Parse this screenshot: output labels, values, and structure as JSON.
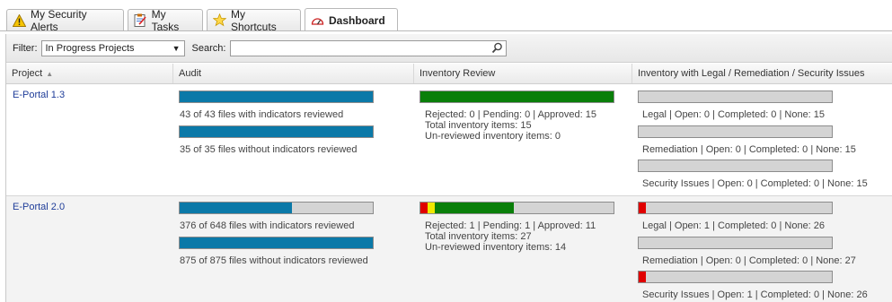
{
  "tabs": [
    {
      "label": "My Security Alerts",
      "icon": "warning-icon"
    },
    {
      "label": "My Tasks",
      "icon": "tasks-icon"
    },
    {
      "label": "My Shortcuts",
      "icon": "star-icon"
    },
    {
      "label": "Dashboard",
      "icon": "gauge-icon"
    }
  ],
  "filter": {
    "label": "Filter:",
    "value": "In Progress Projects",
    "search_label": "Search:",
    "search_value": ""
  },
  "columns": {
    "project": "Project",
    "audit": "Audit",
    "inventory": "Inventory Review",
    "issues": "Inventory with Legal / Remediation / Security Issues"
  },
  "colors": {
    "audit_fill": "#0b79a8",
    "rejected": "#e00000",
    "pending": "#f0e800",
    "approved": "#0a7f0a",
    "empty": "#d4d4d4",
    "link": "#1f3d99"
  },
  "rows": [
    {
      "project": "E-Portal 1.3",
      "audit_with_fraction": 1.0,
      "audit_with_text": "43 of 43 files with indicators reviewed",
      "audit_without_fraction": 1.0,
      "audit_without_text": "35 of 35 files without indicators reviewed",
      "inv_rejected": 0,
      "inv_pending": 0,
      "inv_approved": 15,
      "inv_total": 15,
      "inv_line1": "Rejected: 0  |  Pending: 0  |  Approved: 15",
      "inv_line2": "Total inventory items: 15",
      "inv_line3": "Un-reviewed inventory items: 0",
      "legal_open": 0,
      "legal_total": 15,
      "legal_text": "Legal  |  Open: 0  |  Completed: 0  |  None: 15",
      "remed_open": 0,
      "remed_total": 15,
      "remed_text": "Remediation  |  Open: 0  |  Completed: 0  |  None: 15",
      "sec_open": 0,
      "sec_total": 15,
      "sec_text": "Security Issues  |  Open: 0  |  Completed: 0  |  None: 15"
    },
    {
      "project": "E-Portal 2.0",
      "audit_with_fraction": 0.58,
      "audit_with_text": "376 of 648 files with indicators reviewed",
      "audit_without_fraction": 1.0,
      "audit_without_text": "875 of 875 files without indicators reviewed",
      "inv_rejected": 1,
      "inv_pending": 1,
      "inv_approved": 11,
      "inv_total": 27,
      "inv_line1": "Rejected: 1  |  Pending: 1  |  Approved: 11",
      "inv_line2": "Total inventory items: 27",
      "inv_line3": "Un-reviewed inventory items: 14",
      "legal_open": 1,
      "legal_total": 27,
      "legal_text": "Legal  |  Open: 1  |  Completed: 0  |  None: 26",
      "remed_open": 0,
      "remed_total": 27,
      "remed_text": "Remediation  |  Open: 0  |  Completed: 0  |  None: 27",
      "sec_open": 1,
      "sec_total": 27,
      "sec_text": "Security Issues  |  Open: 1  |  Completed: 0  |  None: 26"
    }
  ]
}
